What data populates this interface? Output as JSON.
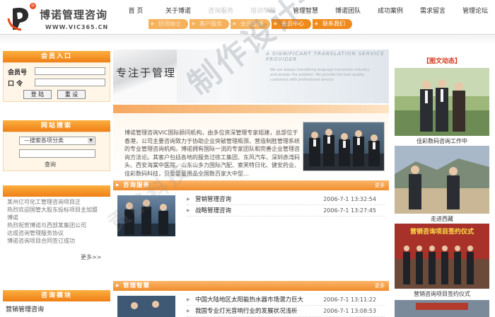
{
  "logo": {
    "name": "博诺管理咨询",
    "url": "WWW.VIC365.CN",
    "side_text": "VIC365"
  },
  "topnav": [
    {
      "label": "首 页",
      "dim": false
    },
    {
      "label": "关于博诺",
      "dim": false
    },
    {
      "label": "咨询服务",
      "dim": true
    },
    {
      "label": "培训学院",
      "dim": true
    },
    {
      "label": "管理智慧",
      "dim": false
    },
    {
      "label": "博诺团队",
      "dim": false
    },
    {
      "label": "成功案例",
      "dim": false
    },
    {
      "label": "需求留言",
      "dim": false
    },
    {
      "label": "管理论坛",
      "dim": false
    }
  ],
  "subnav": [
    {
      "label": "招贤纳士",
      "dim": true
    },
    {
      "label": "客户服务",
      "dim": true
    },
    {
      "label": "会员在线",
      "dim": true
    },
    {
      "label": "会员中心",
      "dim": false
    },
    {
      "label": "联系我们",
      "dim": false
    }
  ],
  "login": {
    "title": "会员入口",
    "user_label": "会员号",
    "pass_label": "口  令",
    "login_button": "登 陆",
    "reset_button": "重 设"
  },
  "search": {
    "title": "网站搜索",
    "select_value": "—搜索各项分类",
    "button": "查询"
  },
  "news": {
    "items": [
      "某州亿可化工管理咨询项目正",
      "热烈欢迎国管大股东投标项目主加盟",
      "博诺",
      "热烈祝贺博诺与西部某集团公司",
      "达成咨询管理服务协议",
      "博诺咨询项目合同签订成功"
    ],
    "more": "更多>>"
  },
  "consult": {
    "title": "咨询模块",
    "item": "营销管理咨询"
  },
  "banner": {
    "title": "专注于管理",
    "eng": "A SIGNIFICANT TRANSLATION SERVICE PROVIDER",
    "eng2": "We are always translating language translation industry and answer the problem. We provide the best quality customers with professional service"
  },
  "about": {
    "text": "博诺管理咨询VIC国际顾问机构，由多位资深管理专家组建，总部位于香港，公司主要咨询致力于协助企业突破管理瓶颈、营造制胜管理系统的专业管理咨询机构。博诺拥有国际一流的专家团队和完善企业管理咨询方法论。其客户包括各地的服务过徐工集团、东风汽车、深圳赤湾码头、西安海棠中医院、山东山多力国际汽配、索芙特日化、健安药业、佳彩数码科技，贝爱婴童用品全国数百家大中型…"
  },
  "consult_section": {
    "label": "咨询服务",
    "more": "更多",
    "rows": [
      {
        "title": "营销管理咨询",
        "date": "2006-7-1 13:32:54"
      },
      {
        "title": "战略管理咨询",
        "date": "2006-7-1 13:27:45"
      }
    ]
  },
  "wisdom_section": {
    "label": "管理智慧",
    "more": "更多",
    "rows": [
      {
        "title": "中国大陆地区太阳能热水器市场潜力巨大",
        "date": "2006-7-1 13:11:22"
      },
      {
        "title": "我国专业灯光音响行业的发展状况浅析",
        "date": "2006-7-1 13:08:53"
      }
    ]
  },
  "photo_news": {
    "title": "【图文动态】",
    "captions": [
      "佳彩数码咨询工作中",
      "走进西藏",
      "营销咨询项目签约仪式"
    ],
    "overlay": "营销咨询项目签约仪式"
  },
  "watermark": {
    "primary": "制作设计一鹏",
    "secondary": "贡鹏科技"
  },
  "colors": {
    "accent": "#f08a1c",
    "accent_light": "#fbb040",
    "panel_bg": "#fff6e8",
    "red_title": "#d23a1c"
  }
}
